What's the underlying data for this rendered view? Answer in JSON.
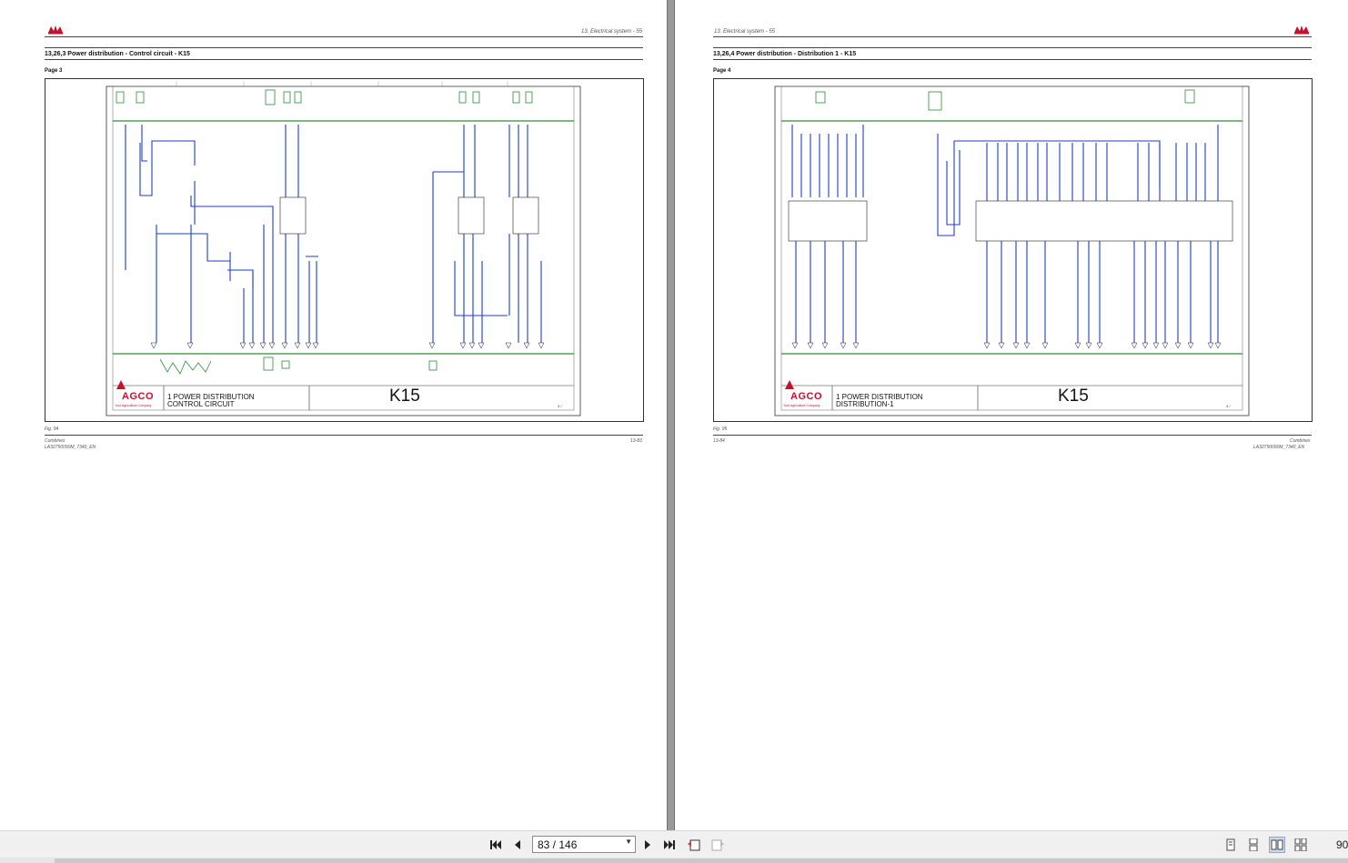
{
  "left_page": {
    "header": "13. Electrical system - 55",
    "section_title": "13,26,3  Power distribution - Control circuit - K15",
    "page_label": "Page 3",
    "diagram": {
      "big_label": "K15",
      "title_line1": "1 POWER DISTRIBUTION",
      "title_line2": "CONTROL CIRCUIT",
      "sheet": "3 /",
      "brand": "AGCO",
      "brand_sub": "Your Agriculture Company"
    },
    "fig": "Fig. 94",
    "footer_left_line1": "Combines",
    "footer_left_line2": "LA32750090M_7340_EN",
    "footer_right": "13-83"
  },
  "right_page": {
    "header": "13. Electrical system - 55",
    "section_title": "13,26,4  Power distribution - Distribution 1 - K15",
    "page_label": "Page 4",
    "diagram": {
      "big_label": "K15",
      "title_line1": "1 POWER DISTRIBUTION",
      "title_line2": "DISTRIBUTION-1",
      "sheet": "4 /",
      "brand": "AGCO",
      "brand_sub": "Your Agriculture Company"
    },
    "fig": "Fig. 95",
    "footer_left": "13-84",
    "footer_right_line1": "Combines",
    "footer_right_line2": "LA32750090M_7340_EN"
  },
  "toolbar": {
    "page_value": "83 / 146",
    "zoom": "90"
  },
  "colors": {
    "wire_blue": "#1f3ec7",
    "ground_green": "#2e8b3a",
    "brand_red": "#c8102e"
  }
}
